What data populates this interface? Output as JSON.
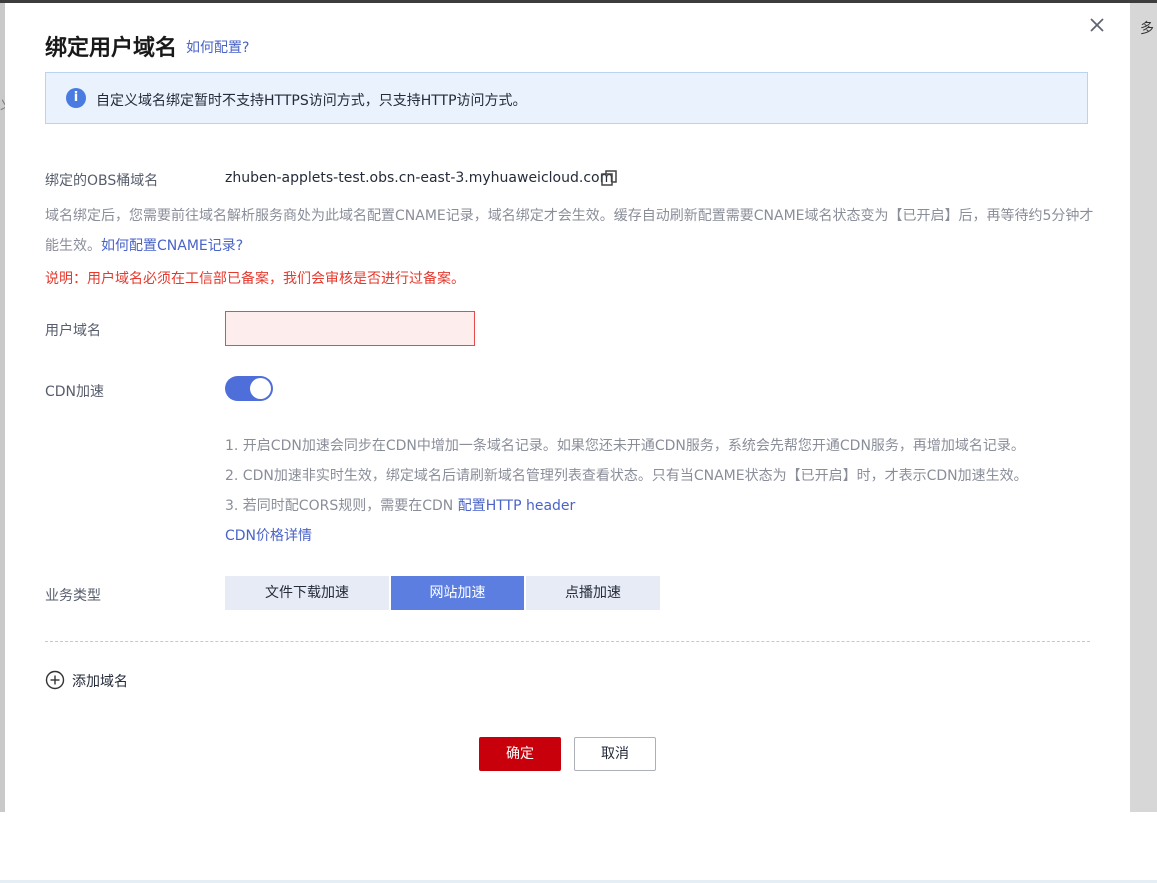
{
  "background": {
    "right_text": "多",
    "left_text": "义"
  },
  "dialog": {
    "title": "绑定用户域名",
    "help_link": "如何配置?",
    "notice": "自定义域名绑定暂时不支持HTTPS访问方式，只支持HTTP访问方式。",
    "obs_label": "绑定的OBS桶域名",
    "obs_value": "zhuben-applets-test.obs.cn-east-3.myhuaweicloud.com",
    "hint_text": "域名绑定后，您需要前往域名解析服务商处为此域名配置CNAME记录，域名绑定才会生效。缓存自动刷新配置需要CNAME域名状态变为【已开启】后，再等待约5分钟才能生效。",
    "hint_link": "如何配置CNAME记录?",
    "warning": "说明：用户域名必须在工信部已备案，我们会审核是否进行过备案。",
    "domain_label": "用户域名",
    "domain_value": "",
    "cdn_label": "CDN加速",
    "cdn_enabled": true,
    "cdn_notes": [
      "1. 开启CDN加速会同步在CDN中增加一条域名记录。如果您还未开通CDN服务，系统会先帮您开通CDN服务，再增加域名记录。",
      "2. CDN加速非实时生效，绑定域名后请刷新域名管理列表查看状态。只有当CNAME状态为【已开启】时，才表示CDN加速生效。",
      "3. 若同时配CORS规则，需要在CDN "
    ],
    "cdn_note3_link": "配置HTTP header",
    "cdn_price_link": "CDN价格详情",
    "business_label": "业务类型",
    "business_options": [
      "文件下载加速",
      "网站加速",
      "点播加速"
    ],
    "business_selected": "网站加速",
    "add_domain": "添加域名",
    "confirm": "确定",
    "cancel": "取消"
  },
  "colors": {
    "brand_red": "#c7000b",
    "link_blue": "#4a63c8",
    "toggle_on": "#4e6fd9",
    "warning_red": "#e5392e"
  }
}
